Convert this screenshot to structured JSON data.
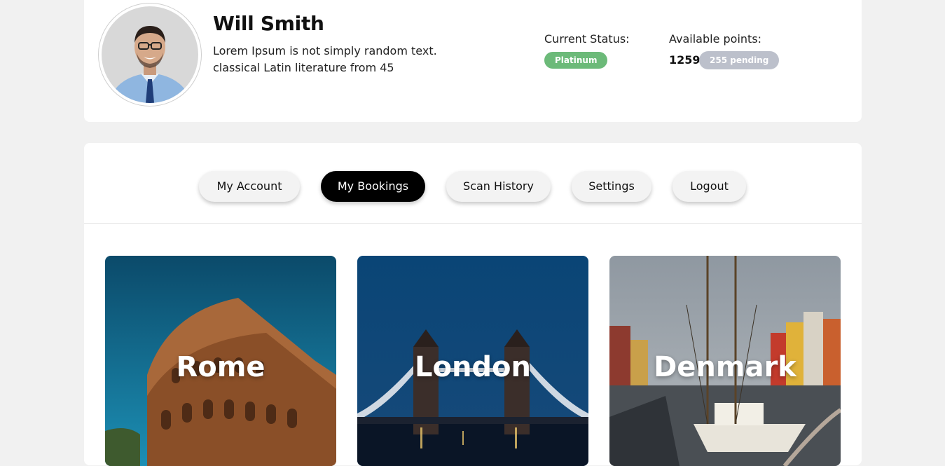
{
  "profile": {
    "name": "Will Smith",
    "bio_line1": "Lorem Ipsum is not simply random text.",
    "bio_line2": "classical Latin literature from 45",
    "status_label": "Current Status:",
    "status_value": "Platinum",
    "points_label": "Available points:",
    "points_value": "1259",
    "points_pending": "255 pending",
    "status_color": "#6cba79",
    "pending_color": "#bcc0cb"
  },
  "tabs": [
    {
      "label": "My Account",
      "active": false
    },
    {
      "label": "My Bookings",
      "active": true
    },
    {
      "label": "Scan History",
      "active": false
    },
    {
      "label": "Settings",
      "active": false
    },
    {
      "label": "Logout",
      "active": false
    }
  ],
  "destinations": [
    {
      "name": "Rome"
    },
    {
      "name": "London"
    },
    {
      "name": "Denmark"
    }
  ],
  "icons": {
    "avatar": "user-photo"
  }
}
